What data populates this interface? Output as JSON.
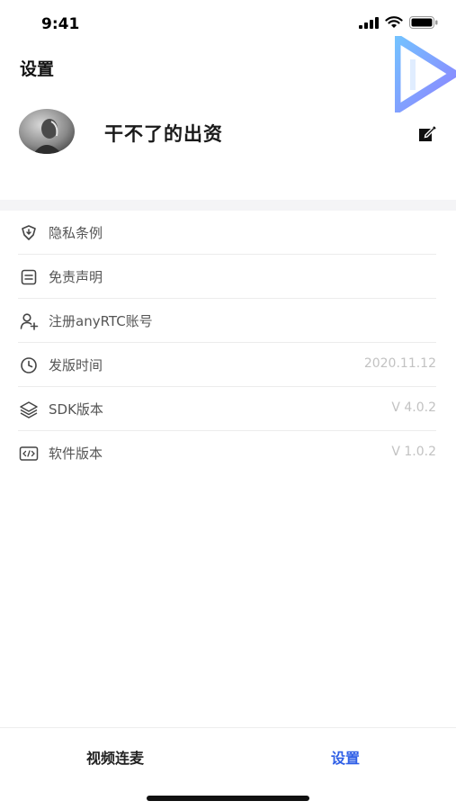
{
  "status": {
    "time": "9:41"
  },
  "page": {
    "title": "设置"
  },
  "profile": {
    "name": "干不了的出资"
  },
  "menu": [
    {
      "label": "隐私条例",
      "value": "",
      "icon": "shield-icon"
    },
    {
      "label": "免责声明",
      "value": "",
      "icon": "document-icon"
    },
    {
      "label": "注册anyRTC账号",
      "value": "",
      "icon": "add-user-icon"
    },
    {
      "label": "发版时间",
      "value": "2020.11.12",
      "icon": "clock-icon"
    },
    {
      "label": "SDK版本",
      "value": "V 4.0.2",
      "icon": "layers-icon"
    },
    {
      "label": "软件版本",
      "value": "V 1.0.2",
      "icon": "code-icon"
    }
  ],
  "tabs": [
    {
      "label": "视频连麦",
      "active": false
    },
    {
      "label": "设置",
      "active": true
    }
  ],
  "colors": {
    "accent": "#2f5fe6",
    "value_text": "#c2c2c2",
    "section_gap": "#f4f4f6"
  }
}
